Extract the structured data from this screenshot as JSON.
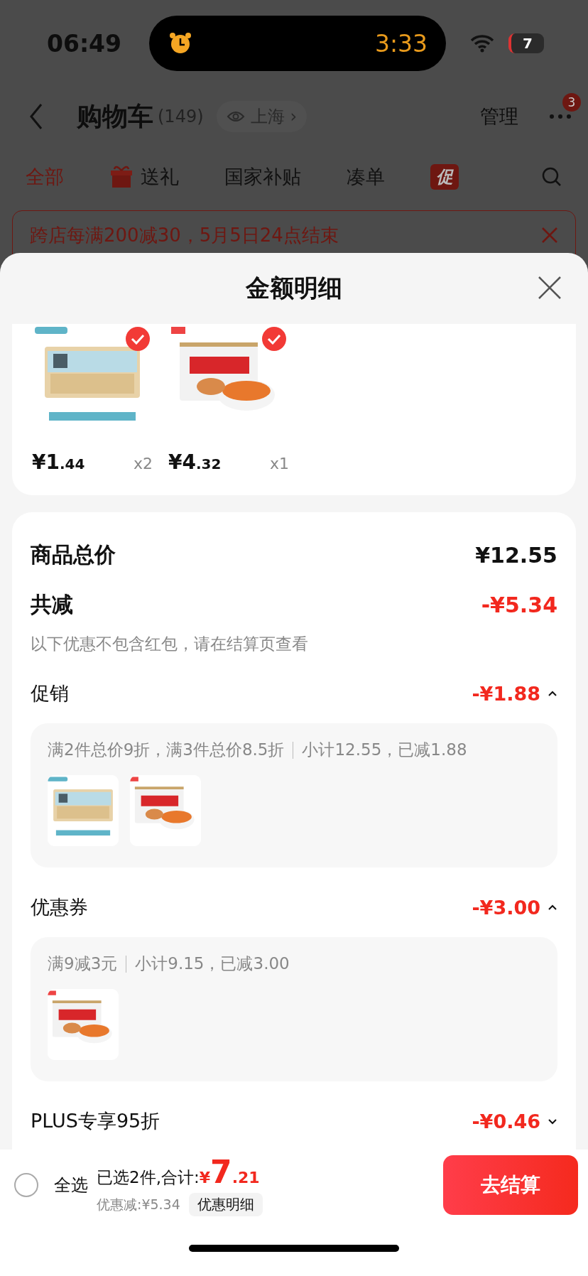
{
  "status_bar": {
    "time": "06:49",
    "timer": "3:33",
    "battery": "7"
  },
  "nav": {
    "title": "购物车",
    "count": "(149)",
    "location": "上海",
    "chevron": "›",
    "manage": "管理",
    "badge": "3"
  },
  "tabs": [
    {
      "label": "全部",
      "selected": true,
      "kind": "text"
    },
    {
      "label": "送礼",
      "selected": false,
      "kind": "gift"
    },
    {
      "label": "国家补贴",
      "selected": false,
      "kind": "text"
    },
    {
      "label": "凑单",
      "selected": false,
      "kind": "text"
    },
    {
      "label": "促",
      "selected": false,
      "kind": "badge"
    }
  ],
  "banner": {
    "text": "跨店每满200减30，5月5日24点结束"
  },
  "sheet": {
    "title": "金额明细"
  },
  "products": [
    {
      "selected": true,
      "price_main": "¥1",
      "price_decimal": ".44",
      "quantity": "x2"
    },
    {
      "selected": true,
      "price_main": "¥4",
      "price_decimal": ".32",
      "quantity": "x1"
    }
  ],
  "summary": {
    "total_label": "商品总价",
    "total": "¥12.55",
    "discount_label": "共减",
    "discount": "-¥5.34",
    "note": "以下优惠不包含红包，请在结算页查看"
  },
  "discounts": [
    {
      "label": "促销",
      "amount": "-¥1.88",
      "expanded": true,
      "rule": "满2件总价9折，满3件总价8.5折",
      "subtotal": "小计12.55，已减1.88"
    },
    {
      "label": "优惠券",
      "amount": "-¥3.00",
      "expanded": true,
      "rule": "满9减3元",
      "subtotal": "小计9.15，已减3.00"
    },
    {
      "label": "PLUS专享95折",
      "amount": "-¥0.46",
      "expanded": false
    }
  ],
  "footer": {
    "select_all": "全选",
    "checked": false,
    "total_label": "已选2件,合计:",
    "currency": "¥",
    "total_main": "7",
    "total_decimal": ".21",
    "saved": "优惠减:¥5.34",
    "details": "优惠明细",
    "checkout": "去结算"
  }
}
